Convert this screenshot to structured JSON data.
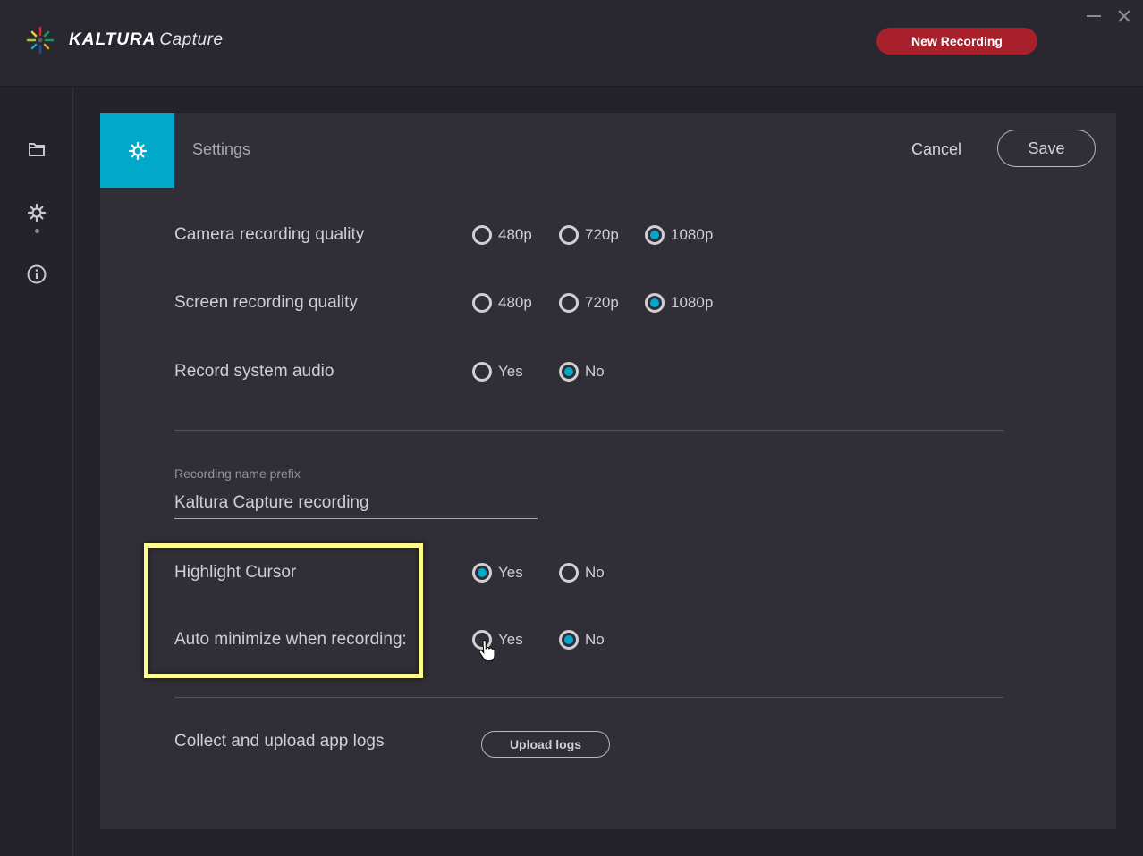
{
  "app": {
    "brand": "KALTURA",
    "product": "Capture",
    "new_recording_label": "New Recording",
    "accent_color": "#00a8c9",
    "record_color": "#a8202b"
  },
  "window_controls": {
    "minimize_icon": "minimize-icon",
    "close_icon": "close-icon"
  },
  "sidebar": {
    "items": [
      {
        "name": "library",
        "icon": "folder-icon"
      },
      {
        "name": "settings",
        "icon": "gear-icon",
        "active": true
      },
      {
        "name": "about",
        "icon": "info-icon"
      }
    ]
  },
  "panel": {
    "title": "Settings",
    "icon": "gear-icon",
    "cancel_label": "Cancel",
    "save_label": "Save"
  },
  "settings": {
    "camera_quality": {
      "label": "Camera recording quality",
      "options": [
        "480p",
        "720p",
        "1080p"
      ],
      "selected": "1080p"
    },
    "screen_quality": {
      "label": "Screen recording quality",
      "options": [
        "480p",
        "720p",
        "1080p"
      ],
      "selected": "1080p"
    },
    "system_audio": {
      "label": "Record system audio",
      "options": [
        "Yes",
        "No"
      ],
      "selected": "No"
    },
    "name_prefix": {
      "label": "Recording name prefix",
      "value": "Kaltura Capture recording"
    },
    "highlight_cursor": {
      "label": "Highlight Cursor",
      "options": [
        "Yes",
        "No"
      ],
      "selected": "Yes"
    },
    "auto_minimize": {
      "label": "Auto minimize when recording:",
      "options": [
        "Yes",
        "No"
      ],
      "selected": "No"
    },
    "logs": {
      "label": "Collect and upload app logs",
      "button_label": "Upload logs"
    }
  }
}
